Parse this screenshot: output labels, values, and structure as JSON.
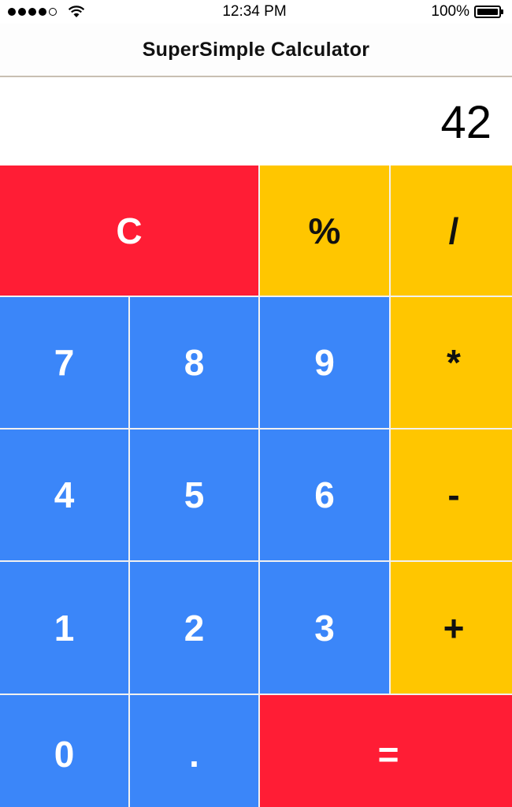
{
  "status_bar": {
    "time": "12:34 PM",
    "battery_text": "100%",
    "battery_level": 1.0,
    "signal_bars_filled": 4,
    "signal_bars_total": 5
  },
  "nav": {
    "title": "SuperSimple Calculator"
  },
  "display": {
    "value": "42"
  },
  "keys": {
    "clear": "C",
    "percent": "%",
    "divide": "/",
    "seven": "7",
    "eight": "8",
    "nine": "9",
    "multiply": "*",
    "four": "4",
    "five": "5",
    "six": "6",
    "minus": "-",
    "one": "1",
    "two": "2",
    "three": "3",
    "plus": "+",
    "zero": "0",
    "decimal": ".",
    "equals": "="
  },
  "colors": {
    "number_key": "#3b86f9",
    "operator_key": "#ffc600",
    "accent_red": "#ff1d35",
    "key_gap": "#f1f1f1"
  },
  "icons": {
    "signal": "cellular-signal-icon",
    "wifi": "wifi-icon",
    "battery": "battery-icon"
  }
}
